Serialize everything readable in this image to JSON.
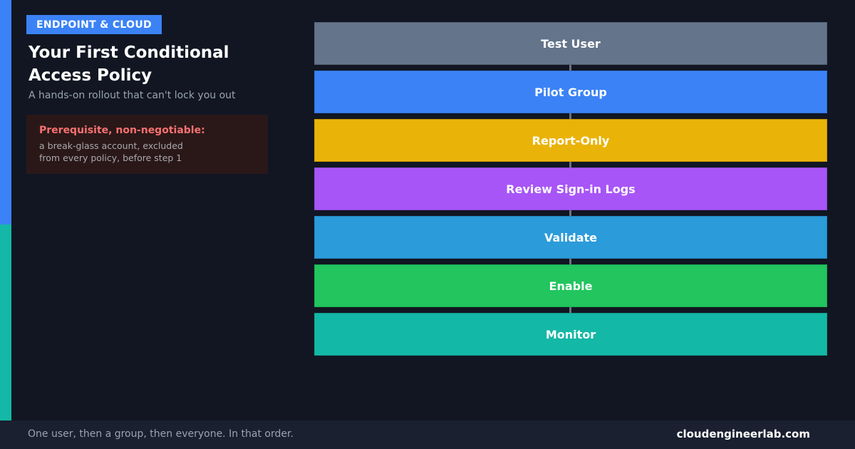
{
  "category_badge": "ENDPOINT & CLOUD",
  "title_line1": "Your First Conditional",
  "title_line2": "Access Policy",
  "subtitle": "A hands-on rollout that can't lock you out",
  "prerequisite": {
    "heading": "Prerequisite, non-negotiable:",
    "line1": "a break-glass account, excluded",
    "line2": "from every policy, before step 1"
  },
  "steps": [
    {
      "label": "Test User",
      "color": "#64748b"
    },
    {
      "label": "Pilot Group",
      "color": "#3b82f6"
    },
    {
      "label": "Report-Only",
      "color": "#eab308"
    },
    {
      "label": "Review Sign-in Logs",
      "color": "#a855f7"
    },
    {
      "label": "Validate",
      "color": "#2b9bda"
    },
    {
      "label": "Enable",
      "color": "#22c55e"
    },
    {
      "label": "Monitor",
      "color": "#14b8a6"
    }
  ],
  "footer": {
    "tagline": "One user, then a group, then everyone. In that order.",
    "site": "cloudengineerlab.com"
  },
  "colors": {
    "background": "#111622",
    "accent_blue": "#3b82f6",
    "accent_teal": "#14b8a6",
    "warning_red": "#f87171"
  }
}
